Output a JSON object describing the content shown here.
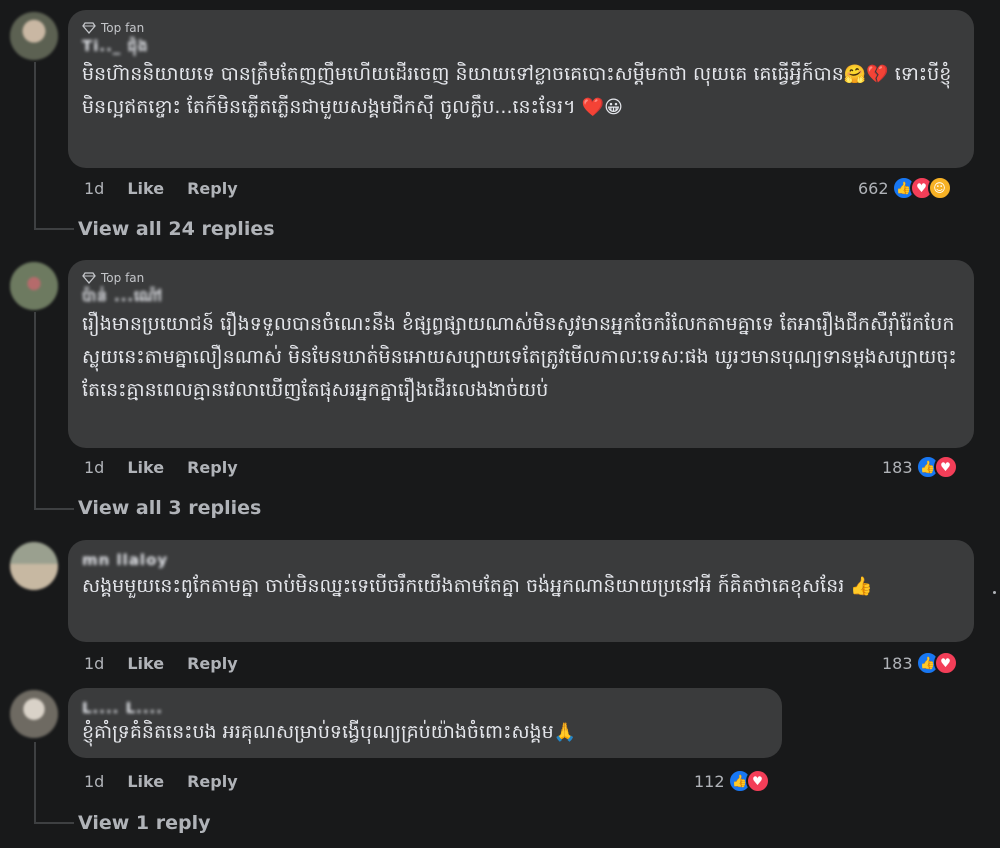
{
  "comments": [
    {
      "badge": "Top fan",
      "author": "Ti.._ ជ៉ុង",
      "text": "មិនហ៊ាននិយាយទេ បានត្រឹមតែញញឹមហើយដើរចេញ និយាយទៅខ្លាចគេបោះសម្តីមកថា លុយគេ គេធ្វើអ្វីក៍បាន",
      "text_tail": "ទោះបីខ្ញុំមិនល្អឥតខ្ចោះ តែក៍មិនភ្លើតភ្លើនជាមួយសង្គមជីកស៊ី ចូលក្លឹប...នេះនែរ។",
      "emoji_mid": "🤗💔",
      "emoji_end": "❤️😀",
      "time": "1d",
      "like_label": "Like",
      "reply_label": "Reply",
      "reaction_count": "662",
      "view_replies": "View all 24 replies"
    },
    {
      "badge": "Top fan",
      "author": "ប៉ាន់ ...ណ៉ៅ",
      "text": "រឿងមានប្រយោជន៍ រឿងទទួលបានចំណេះនឹង ខំផ្សព្វផ្សាយណាស់មិនសូវមានអ្នកចែករំលែកតាមគ្នាទេ តែអារឿងជីកសឺរ៉ាំរ៉ែកបែកស្លុយនេះតាមគ្នាលឿនណាស់ មិនមែនឃាត់មិនអោយសប្បាយទេតែត្រូវមើលកាលៈទេសៈផង ឃូរៗមានបុណ្យទានម្តងសប្បាយចុះ តែនេះគ្មានពេលគ្មានវេលាឃើញតែផុសរអ្នកគ្នារឿងដើរលេងងាច់យប់",
      "time": "1d",
      "like_label": "Like",
      "reply_label": "Reply",
      "reaction_count": "183",
      "view_replies": "View all 3 replies"
    },
    {
      "author": "mn llaloy",
      "text": "សង្គមមួយនេះពូកែតាមគ្នា ចាប់មិនឈ្នះទេបើចរឹកយើងតាមតែគ្នា ចង់អ្នកណានិយាយប្រនៅអី ក៍គិតថាគេខុសនែរ",
      "emoji_end": "👍",
      "time": "1d",
      "like_label": "Like",
      "reply_label": "Reply",
      "reaction_count": "183"
    },
    {
      "author": "L.... L....",
      "text": "ខ្ញុំគាំទ្រគំនិតនេះបង អរគុណសម្រាប់ទង្វើបុណ្យគ្រប់យ៉ាងចំពោះសង្គម",
      "emoji_end": "🙏",
      "time": "1d",
      "like_label": "Like",
      "reply_label": "Reply",
      "reaction_count": "112",
      "view_replies": "View 1 reply"
    }
  ],
  "colors": {
    "background": "#18191a",
    "bubble": "#3a3b3c",
    "like": "#1877f2",
    "love": "#f33e58",
    "care": "#f7b125",
    "muted_text": "#b0b3b8"
  },
  "icons": {
    "badge": "diamond-icon",
    "like": "thumbs-up-icon",
    "love": "heart-icon",
    "care": "care-hug-icon"
  }
}
